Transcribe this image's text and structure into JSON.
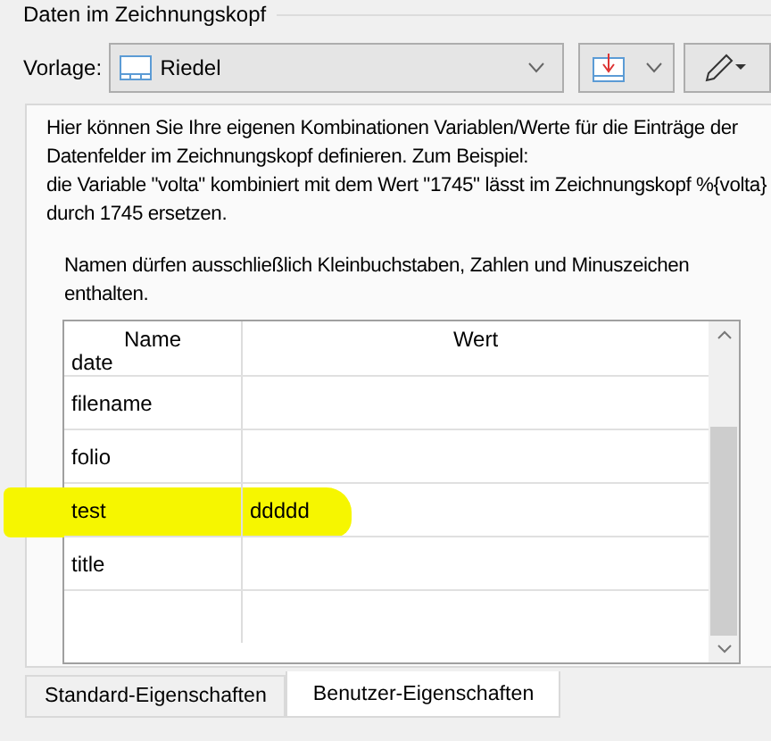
{
  "group": {
    "title": "Daten im Zeichnungskopf"
  },
  "template": {
    "label": "Vorlage:",
    "value": "Riedel"
  },
  "description": "Hier können Sie Ihre eigenen Kombinationen Variablen/Werte für die Einträge der Datenfelder im Zeichnungskopf definieren. Zum Beispiel:\ndie Variable \"volta\" kombiniert mit dem Wert \"1745\" lässt im Zeichnungskopf %{volta} durch 1745 ersetzen.",
  "hint": "Namen dürfen ausschließlich Kleinbuchstaben, Zahlen und Minuszeichen enthalten.",
  "table": {
    "columns": [
      "Name",
      "Wert"
    ],
    "rows": [
      {
        "name": "date",
        "value": "",
        "highlighted": false
      },
      {
        "name": "filename",
        "value": "",
        "highlighted": false
      },
      {
        "name": "folio",
        "value": "",
        "highlighted": false
      },
      {
        "name": "test",
        "value": "ddddd",
        "highlighted": true
      },
      {
        "name": "title",
        "value": "",
        "highlighted": false
      },
      {
        "name": "",
        "value": "",
        "highlighted": false
      }
    ]
  },
  "tabs": [
    {
      "label": "Standard-Eigenschaften",
      "selected": false
    },
    {
      "label": "Benutzer-Eigenschaften",
      "selected": true
    }
  ]
}
